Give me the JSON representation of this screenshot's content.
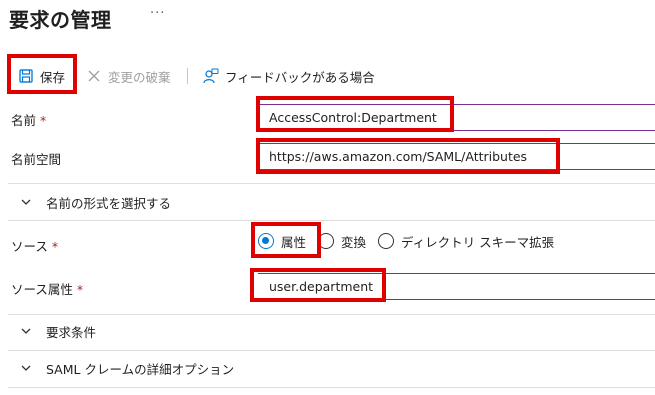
{
  "page": {
    "title": "要求の管理",
    "more": "···"
  },
  "toolbar": {
    "save_label": "保存",
    "discard_label": "変更の破棄",
    "feedback_label": "フィードバックがある場合"
  },
  "form": {
    "name": {
      "label": "名前",
      "required_mark": "*",
      "value": "AccessControl:Department"
    },
    "namespace": {
      "label": "名前空間",
      "value": "https://aws.amazon.com/SAML/Attributes"
    },
    "name_format_section": {
      "label": "名前の形式を選択する"
    },
    "source": {
      "label": "ソース",
      "required_mark": "*",
      "options": [
        "属性",
        "変換",
        "ディレクトリ スキーマ拡張"
      ],
      "selected": "属性"
    },
    "source_attribute": {
      "label": "ソース属性",
      "required_mark": "*",
      "value": "user.department"
    },
    "claim_conditions_section": {
      "label": "要求条件"
    },
    "advanced_saml_section": {
      "label": "SAML クレームの詳細オプション"
    }
  },
  "colors": {
    "accent": "#0078d4",
    "highlight_box": "#e00000",
    "field_underline": "#7a2e8e",
    "required": "#a4262c"
  }
}
